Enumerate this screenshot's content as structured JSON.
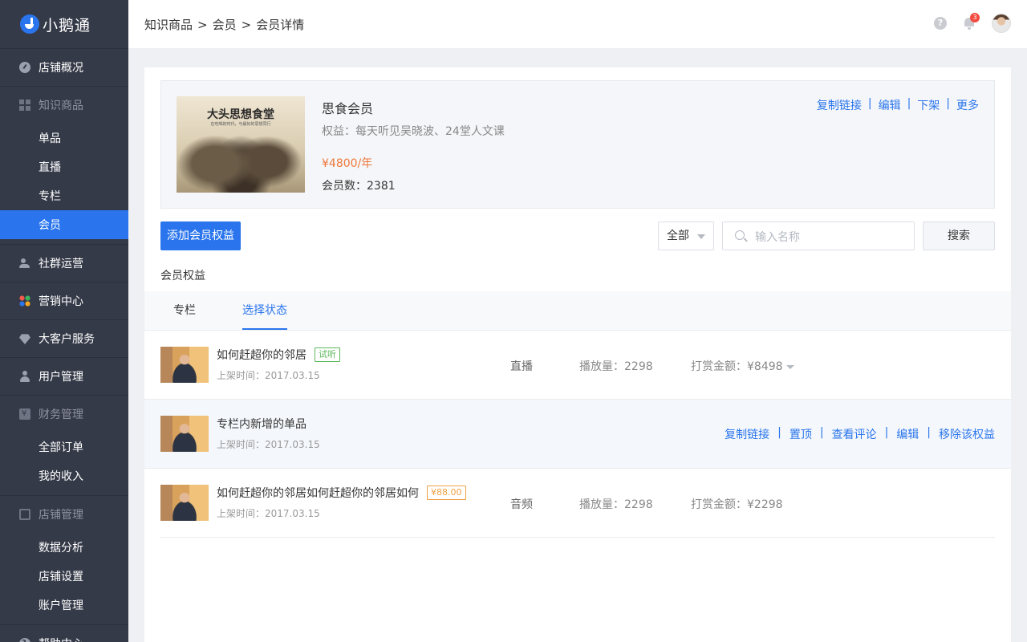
{
  "app": {
    "logo_text": "小鹅通"
  },
  "sidebar": {
    "groups": [
      {
        "label": "店铺概况",
        "icon": "gauge-icon",
        "items": []
      },
      {
        "label": "知识商品",
        "icon": "grid-icon",
        "items": [
          "单品",
          "直播",
          "专栏",
          "会员"
        ],
        "active_item": "会员"
      },
      {
        "label": "社群运营",
        "icon": "people-icon",
        "items": []
      },
      {
        "label": "营销中心",
        "icon": "color-dots-icon",
        "items": []
      },
      {
        "label": "大客户服务",
        "icon": "diamond-icon",
        "items": []
      },
      {
        "label": "用户管理",
        "icon": "user-icon",
        "items": []
      },
      {
        "label": "财务管理",
        "icon": "wallet-icon",
        "items": [
          "全部订单",
          "我的收入"
        ]
      },
      {
        "label": "店铺管理",
        "icon": "phone-icon",
        "items": [
          "数据分析",
          "店铺设置",
          "账户管理"
        ]
      },
      {
        "label": "帮助中心",
        "icon": "help-icon",
        "items": []
      }
    ]
  },
  "header": {
    "breadcrumb": [
      "知识商品",
      "会员",
      "会员详情"
    ],
    "breadcrumb_separator": ">",
    "notification_count": "3",
    "help_glyph": "?"
  },
  "membership": {
    "cover_title": "大头思想食堂",
    "cover_subtitle": "在吃喝的时代，与最好的思想同行",
    "name": "思食会员",
    "rights": "权益：每天听见吴晓波、24堂人文课",
    "price": "¥4800/年",
    "member_count": "会员数：2381",
    "actions": [
      "复制链接",
      "编辑",
      "下架",
      "更多"
    ]
  },
  "toolbar": {
    "add_button": "添加会员权益",
    "filter_value": "全部",
    "search_placeholder": "输入名称",
    "search_button": "搜索"
  },
  "section_label": "会员权益",
  "tabs": [
    {
      "label": "专栏",
      "active": false
    },
    {
      "label": "选择状态",
      "active": true
    }
  ],
  "rows": [
    {
      "title": "如何赶超你的邻居",
      "tag": "试听",
      "tag_color": "#5cb85c",
      "time": "上架时间：2017.03.15",
      "type": "直播",
      "plays": "播放量：2298",
      "tips": "打赏金额：¥8498"
    },
    {
      "title": "专栏内新增的单品",
      "time": "上架时间：2017.03.15",
      "actions": [
        "复制链接",
        "置顶",
        "查看评论",
        "编辑",
        "移除该权益"
      ]
    },
    {
      "title": "如何赶超你的邻居如何赶超你的邻居如何",
      "tag": "¥88.00",
      "tag_color": "#f0a043",
      "time": "上架时间：2017.03.15",
      "type": "音频",
      "plays": "播放量：2298",
      "tips": "打赏金额：¥2298"
    }
  ],
  "colors": {
    "accent": "#2a75ed",
    "sidebar_bg": "#353a48",
    "price": "#f0783c"
  }
}
